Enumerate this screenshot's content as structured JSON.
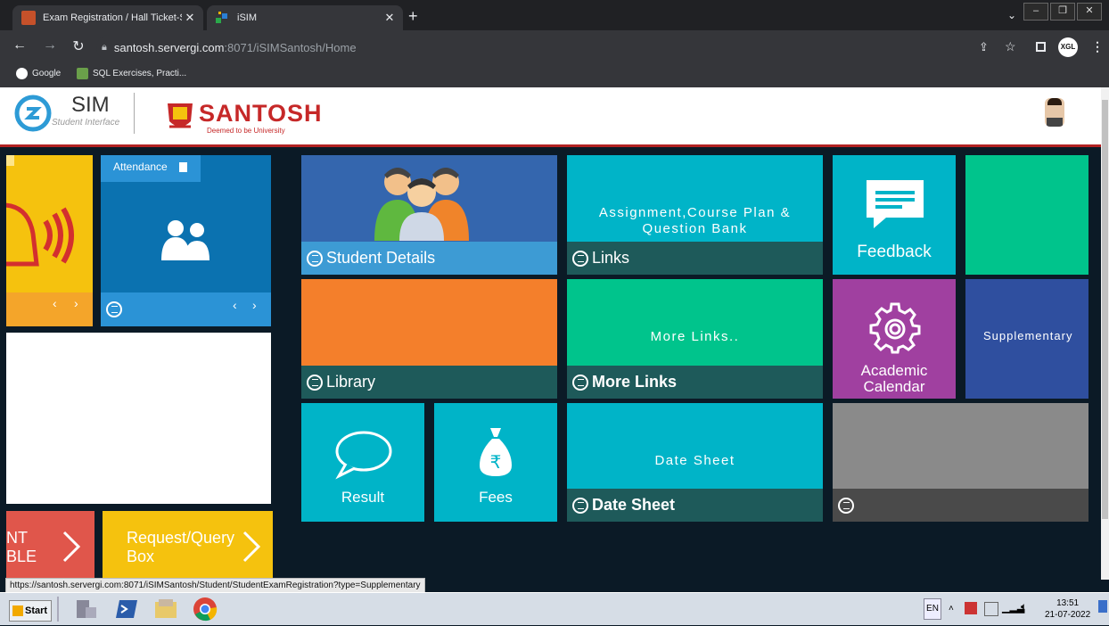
{
  "browser": {
    "tabs": [
      {
        "title": "Exam Registration / Hall Ticket-Sant"
      },
      {
        "title": "iSIM"
      }
    ],
    "url_host": "santosh.servergi.com",
    "url_path": ":8071/iSIMSantosh/Home",
    "bookmarks": [
      "Google",
      "SQL Exercises, Practi..."
    ],
    "profile": "XGL",
    "status_url": "https://santosh.servergi.com:8071/iSIMSantosh/Student/StudentExamRegistration?type=Supplementary"
  },
  "header": {
    "sim_logo_text": "SIM",
    "sim_logo_sub": "Student Interface",
    "university_name": "SANTOSH",
    "university_sub": "Deemed to be University"
  },
  "tiles": {
    "attendance": "Attendance",
    "student_details": "Student Details",
    "assignment_title": "Assignment,Course Plan & Question Bank",
    "links": "Links",
    "feedback": "Feedback",
    "library": "Library",
    "more_links_title": "More Links..",
    "more_links": "More Links",
    "academic_calendar": "Academic Calendar",
    "supplementary": "Supplementary",
    "result": "Result",
    "fees": "Fees",
    "date_sheet_title": "Date Sheet",
    "date_sheet": "Date Sheet",
    "exam_timetable_partial_1": "NT",
    "exam_timetable_partial_2": "BLE",
    "request_query_1": "Request/Query",
    "request_query_2": "Box"
  },
  "colors": {
    "blue": "#3466ae",
    "teal": "#00b4c8",
    "dark_teal": "#1e5a5a",
    "green": "#00c48c",
    "orange": "#f47f2b",
    "purple": "#a040a0",
    "navy": "#2f4f9f",
    "gray": "#8a8a8a",
    "yellow": "#f5c20e",
    "red": "#e0564b",
    "attend": "#0b72b0"
  },
  "taskbar": {
    "start": "Start",
    "lang": "EN",
    "time": "13:51",
    "date": "21-07-2022"
  }
}
